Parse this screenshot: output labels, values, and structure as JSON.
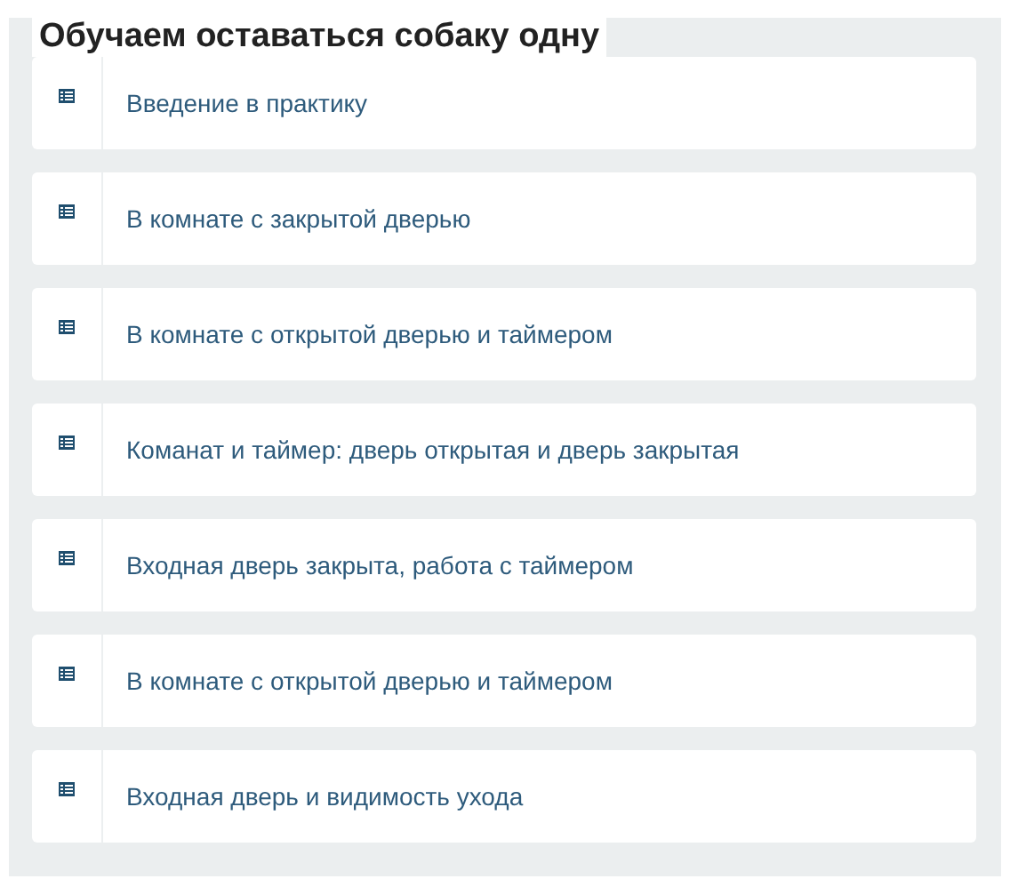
{
  "title": "Обучаем оставаться собаку одну",
  "lessons": [
    {
      "label": "Введение в практику"
    },
    {
      "label": "В комнате с закрытой дверью"
    },
    {
      "label": "В комнате с открытой дверью и таймером"
    },
    {
      "label": "Команат и таймер: дверь открытая и дверь закрытая"
    },
    {
      "label": "Входная дверь закрыта, работа с таймером"
    },
    {
      "label": "В комнате с открытой дверью и таймером"
    },
    {
      "label": "Входная дверь и видимость ухода"
    }
  ]
}
